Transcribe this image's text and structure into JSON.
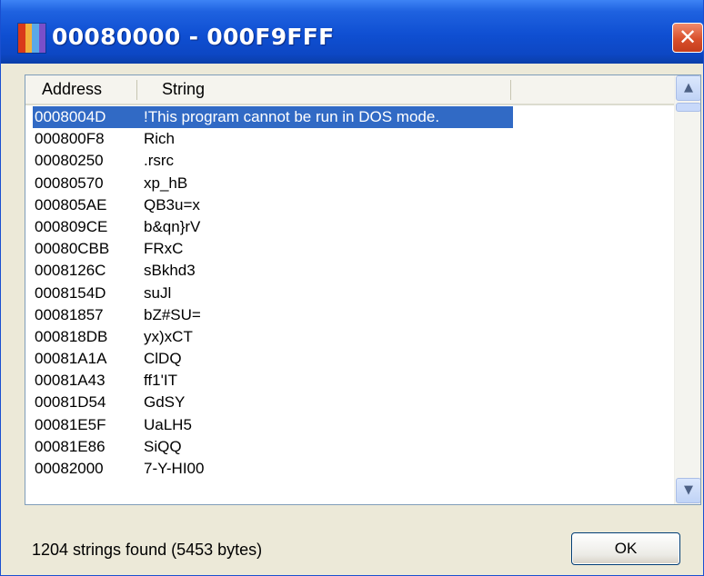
{
  "window": {
    "title": "00080000 - 000F9FFF",
    "close_glyph": "✕",
    "icon": "multicolor-bars-icon",
    "icon_colors": [
      "#d93a1a",
      "#f2b13c",
      "#5aa8e8",
      "#7a4fc9"
    ]
  },
  "list": {
    "columns": {
      "address": "Address",
      "string": "String"
    },
    "rows": [
      {
        "address": "0008004D",
        "string": "!This program cannot be run in DOS mode.",
        "selected": true
      },
      {
        "address": "000800F8",
        "string": "Rich"
      },
      {
        "address": "00080250",
        "string": ".rsrc"
      },
      {
        "address": "00080570",
        "string": "xp_hB"
      },
      {
        "address": "000805AE",
        "string": "QB3u=x"
      },
      {
        "address": "000809CE",
        "string": "b&qn}rV"
      },
      {
        "address": "00080CBB",
        "string": "FRxC"
      },
      {
        "address": "0008126C",
        "string": "sBkhd3"
      },
      {
        "address": "0008154D",
        "string": "suJl"
      },
      {
        "address": "00081857",
        "string": "bZ#SU="
      },
      {
        "address": "000818DB",
        "string": "yx)xCT"
      },
      {
        "address": "00081A1A",
        "string": "ClDQ"
      },
      {
        "address": "00081A43",
        "string": "ff1'IT"
      },
      {
        "address": "00081D54",
        "string": "GdSY"
      },
      {
        "address": "00081E5F",
        "string": "UaLH5"
      },
      {
        "address": "00081E86",
        "string": "SiQQ"
      },
      {
        "address": "00082000",
        "string": "7-Y-HI00"
      }
    ],
    "scroll_up_glyph": "▲",
    "scroll_down_glyph": "▼"
  },
  "status": {
    "text": "1204 strings found (5453 bytes)"
  },
  "buttons": {
    "ok": "OK"
  },
  "colors": {
    "titlebar": "#0d47c4",
    "selection": "#316ac5",
    "face": "#ece9d8",
    "close": "#d9502c"
  }
}
